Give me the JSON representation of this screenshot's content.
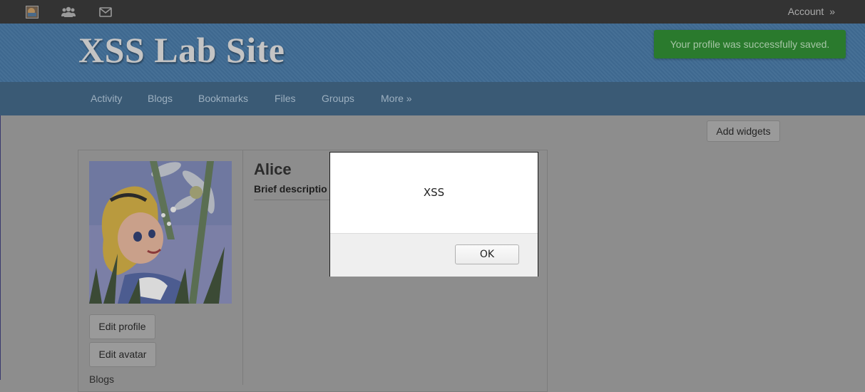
{
  "topbar": {
    "account_label": "Account",
    "account_chevron": "»",
    "icons": [
      "site-logo-icon",
      "friends-icon",
      "mail-icon"
    ]
  },
  "header": {
    "site_title": "XSS Lab Site",
    "flash_message": "Your profile was successfully saved."
  },
  "nav": {
    "items": [
      {
        "label": "Activity"
      },
      {
        "label": "Blogs"
      },
      {
        "label": "Bookmarks"
      },
      {
        "label": "Files"
      },
      {
        "label": "Groups"
      },
      {
        "label": "More »"
      }
    ]
  },
  "toolbar": {
    "add_widgets_label": "Add widgets"
  },
  "profile": {
    "name": "Alice",
    "brief_description_label": "Brief descriptio",
    "edit_profile_label": "Edit profile",
    "edit_avatar_label": "Edit avatar",
    "blogs_label": "Blogs"
  },
  "dialog": {
    "message": "XSS",
    "ok_label": "OK"
  },
  "colors": {
    "topbar": "#333333",
    "header": "#3f6a92",
    "nav": "#3a5a75",
    "flash": "#2a7a2d",
    "overlay": "#8d8d8d"
  }
}
